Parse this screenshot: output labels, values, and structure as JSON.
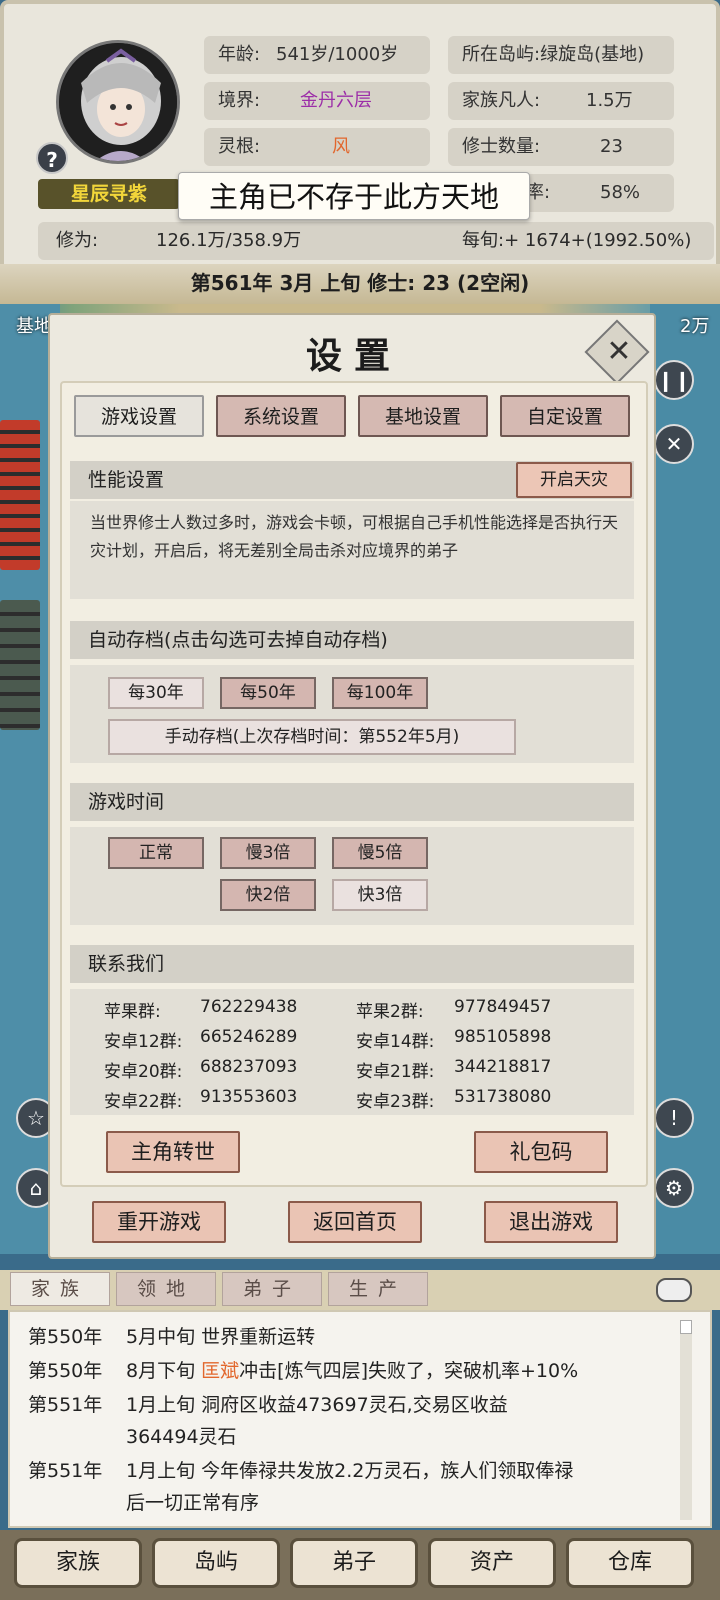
{
  "character": {
    "name": "星辰寻紫",
    "help_symbol": "?",
    "age_label": "年龄:",
    "age_value": "541岁/1000岁",
    "realm_label": "境界:",
    "realm_value": "金丹六层",
    "root_label": "灵根:",
    "root_value": "风",
    "cultivation_label": "修为:",
    "cultivation_value": "126.1万/358.9万"
  },
  "island": {
    "location": "所在岛屿:绿旋岛(基地)",
    "mortals_label": "家族凡人:",
    "mortals_value": "1.5万",
    "cultivators_label": "修士数量:",
    "cultivators_value": "23",
    "rate_partial": "率:",
    "rate_value": "58%",
    "per_period": "每旬:+ 1674+(1992.50%)"
  },
  "tooltip": "主角已不存于此方天地",
  "date_bar": "第561年 3月 上旬   修士: 23 (2空闲)",
  "map_labels": {
    "left": "基地",
    "right": "2万"
  },
  "settings": {
    "title": "设置",
    "tabs": [
      "游戏设置",
      "系统设置",
      "基地设置",
      "自定设置"
    ],
    "performance": {
      "header": "性能设置",
      "button": "开启天灾",
      "description": "当世界修士人数过多时，游戏会卡顿，可根据自己手机性能选择是否执行天灾计划，开启后，将无差别全局击杀对应境界的弟子"
    },
    "autosave": {
      "header": "自动存档(点击勾选可去掉自动存档)",
      "options": [
        "每30年",
        "每50年",
        "每100年"
      ],
      "manual": "手动存档(上次存档时间：第552年5月)"
    },
    "game_time": {
      "header": "游戏时间",
      "options": [
        "正常",
        "慢3倍",
        "慢5倍",
        "快2倍",
        "快3倍"
      ]
    },
    "contact": {
      "header": "联系我们",
      "groups": [
        {
          "label": "苹果群:",
          "number": "762229438"
        },
        {
          "label": "苹果2群:",
          "number": "977849457"
        },
        {
          "label": "安卓12群:",
          "number": "665246289"
        },
        {
          "label": "安卓14群:",
          "number": "985105898"
        },
        {
          "label": "安卓20群:",
          "number": "688237093"
        },
        {
          "label": "安卓21群:",
          "number": "344218817"
        },
        {
          "label": "安卓22群:",
          "number": "913553603"
        },
        {
          "label": "安卓23群:",
          "number": "531738080"
        }
      ]
    },
    "reincarnate": "主角转世",
    "gift_code": "礼包码",
    "restart": "重开游戏",
    "home": "返回首页",
    "exit": "退出游戏"
  },
  "sub_tabs": [
    "家族",
    "领地",
    "弟子",
    "生产"
  ],
  "log": [
    {
      "year": "第550年",
      "text": "5月中旬 世界重新运转"
    },
    {
      "year": "第550年",
      "text_before": "8月下旬 ",
      "highlight": "匡斌",
      "text_after": "冲击[炼气四层]失败了，突破机率+10%"
    },
    {
      "year": "第551年",
      "text": "1月上旬 洞府区收益473697灵石,交易区收益",
      "text2": "364494灵石"
    },
    {
      "year": "第551年",
      "text": "1月上旬 今年俸禄共发放2.2万灵石，族人们领取俸禄",
      "text2": "后一切正常有序"
    }
  ],
  "nav": [
    "家族",
    "岛屿",
    "弟子",
    "资产",
    "仓库"
  ],
  "colors": {
    "accent_purple": "#9c2ea8",
    "accent_orange": "#e2672d",
    "name_gold": "#f2d63a"
  }
}
